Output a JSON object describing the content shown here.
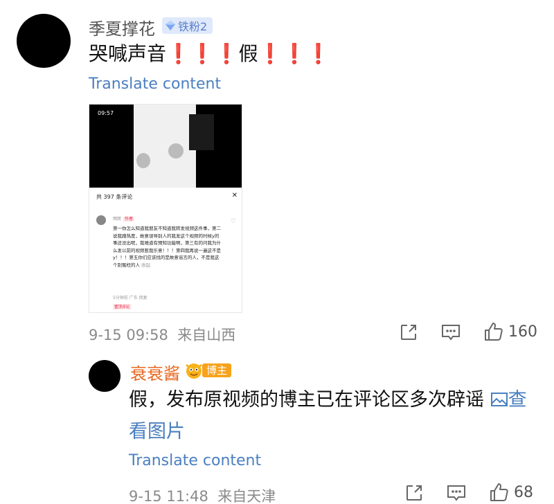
{
  "comment": {
    "username": "季夏撑花",
    "fan_badge": "铁粉2",
    "text_main": "哭喊声音",
    "text_exclaim1": "❗❗❗",
    "text_mid": "假",
    "text_exclaim2": "❗❗❗",
    "translate": "Translate content",
    "timestamp": "9-15 09:58",
    "location": "来自山西",
    "like_count": "160",
    "screenshot": {
      "clock": "09:57",
      "count_label": "共 397 条评论",
      "close": "✕",
      "commenter": "明珲",
      "author_tag": "作者",
      "body": "第一你怎么知道我朋友不知道我转发视频这件事，第二说我蹭热度，故意误导别人的我发这个视频的时候y的事还没出呢，我难道有预知功能啊，第三有的问我为什么发以前的视频惹我乐意！！！第四我再说一遍这不是y！！！第五你们应该找的是故意谣言的人，不是我这个别冤枉的人",
      "collapse": "收起",
      "foot": "5分钟前 广东 回复",
      "pinned": "置顶评论"
    }
  },
  "reply": {
    "username": "衰衰酱",
    "blogger_badge": "博主",
    "text": "假，发布原视频的博主已在评论区多次辟谣",
    "view_image_part1": "查",
    "view_image_part2": "看图片",
    "translate": "Translate content",
    "timestamp": "9-15 11:48",
    "location": "来自天津",
    "like_count": "68"
  },
  "icons": {
    "share": "share-icon",
    "comment": "comment-icon",
    "like": "thumbs-up-icon",
    "image": "image-icon",
    "gem": "diamond-icon"
  },
  "colors": {
    "link": "#4a7fbf",
    "blogger_name": "#e8671f",
    "exclaim": "#e8201a",
    "fan_badge_bg": "#dfe9fb"
  }
}
